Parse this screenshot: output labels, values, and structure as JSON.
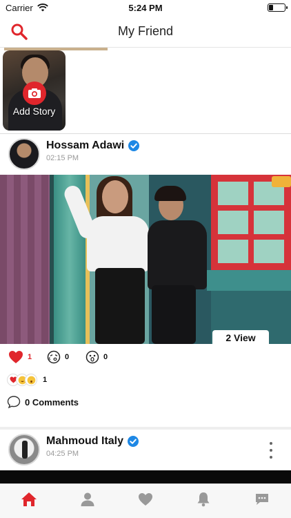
{
  "status_bar": {
    "carrier": "Carrier",
    "time": "5:24 PM"
  },
  "header": {
    "title": "My Friend",
    "search_icon": "search-icon"
  },
  "stories": {
    "add_story_label": "Add Story"
  },
  "posts": [
    {
      "author": "Hossam Adawi",
      "time": "02:15 PM",
      "verified": true,
      "views_label": "2 View",
      "reactions": {
        "love": "1",
        "haha": "0",
        "wow": "0"
      },
      "summary_count": "1",
      "comments_label": "0 Comments"
    },
    {
      "author": "Mahmoud Italy",
      "time": "04:25 PM",
      "verified": true
    }
  ],
  "tabbar": {
    "items": [
      "home-icon",
      "profile-icon",
      "heart-icon",
      "bell-icon",
      "chat-icon"
    ],
    "active": "home-icon"
  },
  "colors": {
    "accent": "#e0262c",
    "verified": "#1e88e5",
    "inactive_icon": "#999999"
  }
}
